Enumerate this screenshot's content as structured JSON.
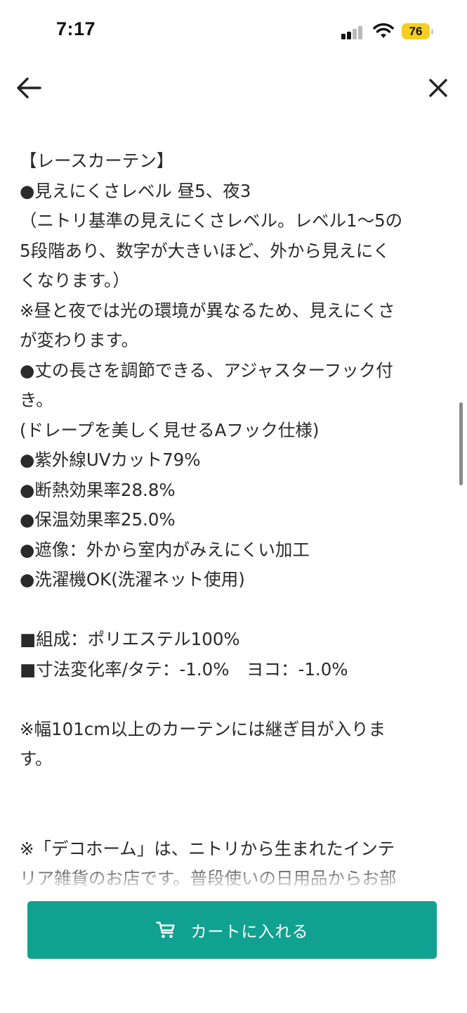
{
  "status_bar": {
    "time": "7:17",
    "battery": "76",
    "battery_color": "#f5cf1f"
  },
  "nav": {
    "back_icon": "arrow-left-icon",
    "close_icon": "close-icon"
  },
  "description_lines": [
    "【レースカーテン】",
    "●見えにくさレベル 昼5、夜3",
    "（ニトリ基準の見えにくさレベル。レベル1～5の",
    "5段階あり、数字が大きいほど、外から見えにく",
    "くなります。）",
    "※昼と夜では光の環境が異なるため、見えにくさ",
    "が変わります。",
    "●丈の長さを調節できる、アジャスターフック付",
    "き。",
    "(ドレープを美しく見せるAフック仕様)",
    "●紫外線UVカット79%",
    "●断熱効果率28.8%",
    "●保温効果率25.0%",
    "●遮像：外から室内がみえにくい加工",
    "●洗濯機OK(洗濯ネット使用)",
    "",
    "■組成：ポリエステル100%",
    "■寸法変化率/タテ：-1.0%　ヨコ：-1.0%",
    "",
    "※幅101cm以上のカーテンには継ぎ目が入りま",
    "す。",
    "",
    "",
    "※「デコホーム」は、ニトリから生まれたインテ",
    "リア雑貨のお店です。普段使いの日用品からお部"
  ],
  "cart_button": {
    "label": "カートに入れる",
    "icon": "cart-icon",
    "color": "#11a190"
  }
}
